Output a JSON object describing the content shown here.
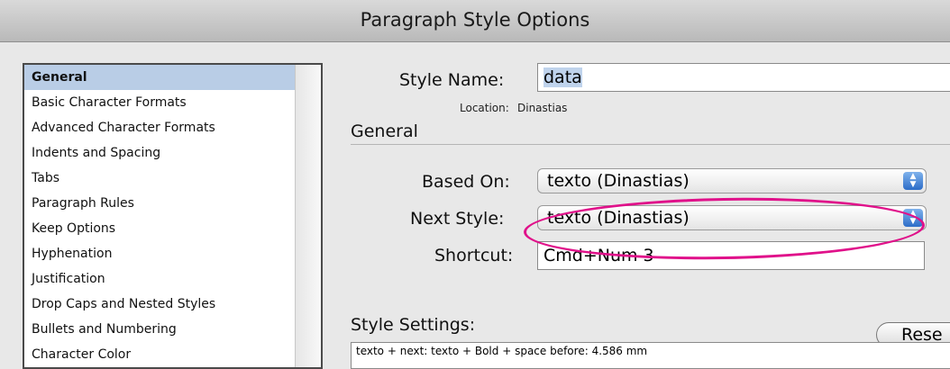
{
  "window": {
    "title": "Paragraph Style Options"
  },
  "sidebar": {
    "items": [
      {
        "label": "General",
        "selected": true
      },
      {
        "label": "Basic Character Formats"
      },
      {
        "label": "Advanced Character Formats"
      },
      {
        "label": "Indents and Spacing"
      },
      {
        "label": "Tabs"
      },
      {
        "label": "Paragraph Rules"
      },
      {
        "label": "Keep Options"
      },
      {
        "label": "Hyphenation"
      },
      {
        "label": "Justification"
      },
      {
        "label": "Drop Caps and Nested Styles"
      },
      {
        "label": "Bullets and Numbering"
      },
      {
        "label": "Character Color"
      }
    ]
  },
  "form": {
    "style_name_label": "Style Name:",
    "style_name_value": "data",
    "location_label": "Location:",
    "location_value": "Dinastias",
    "section_general": "General",
    "based_on_label": "Based On:",
    "based_on_value": "texto (Dinastias)",
    "next_style_label": "Next Style:",
    "next_style_value": "texto (Dinastias)",
    "shortcut_label": "Shortcut:",
    "shortcut_value": "Cmd+Num 3",
    "reset_label": "Rese",
    "style_settings_label": "Style Settings:",
    "style_settings_text": "texto + next: texto + Bold + space before: 4.586 mm"
  },
  "annotation": {
    "color": "#e0118a"
  },
  "colors": {
    "selection": "#b9cde6",
    "popup_arrows": "#2d6dc8"
  }
}
